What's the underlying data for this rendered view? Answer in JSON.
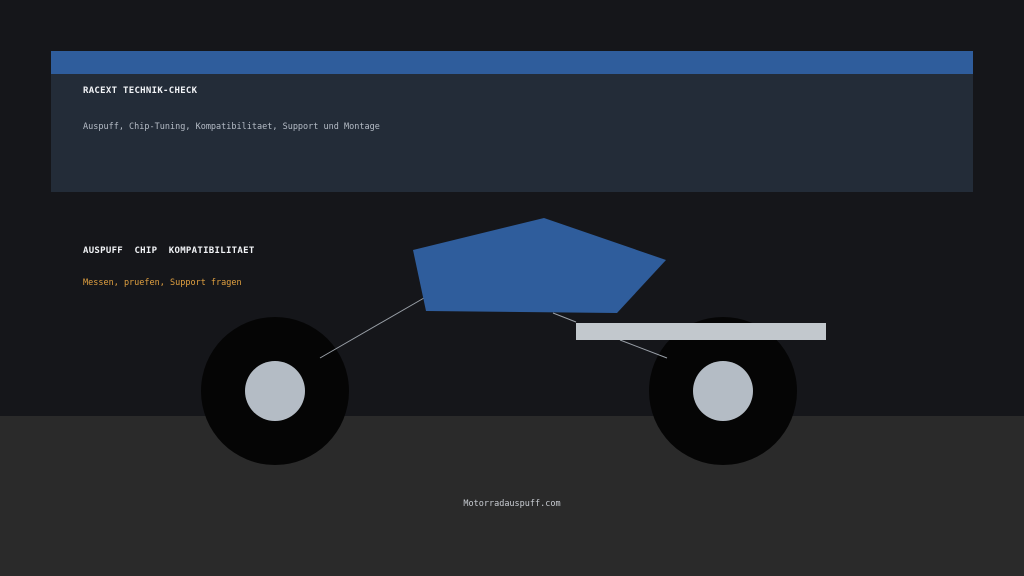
{
  "header": {
    "title": "RACEXT TECHNIK-CHECK",
    "subtitle": "Auspuff, Chip-Tuning, Kompatibilitaet, Support und Montage"
  },
  "feature": {
    "title": "AUSPUFF  CHIP  KOMPATIBILITAET",
    "subtitle": "Messen, pruefen, Support fragen"
  },
  "footer": {
    "domain": "Motorradauspuff.com"
  },
  "colors": {
    "background": "#15161a",
    "ground": "#2a2a2a",
    "accent_blue": "#2f5d9c",
    "card": "#232c38",
    "highlight_orange": "#e0a040",
    "wheel_hub": "#b4bcc5",
    "exhaust": "#c2c8cd"
  },
  "illustration": {
    "parts": [
      "body-panel-icon",
      "front-wheel-icon",
      "rear-wheel-icon",
      "exhaust-pipe-icon"
    ]
  }
}
